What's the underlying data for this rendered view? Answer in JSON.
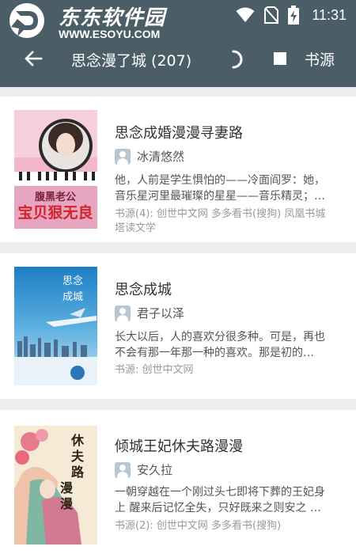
{
  "watermark": {
    "title": "东东软件园",
    "url": "WWW.ESOYU.COM"
  },
  "status_bar": {
    "time": "11:31",
    "icons": [
      "wifi-icon",
      "no-sim-icon",
      "battery-charging-icon"
    ]
  },
  "toolbar": {
    "back_icon": "arrow-left-icon",
    "title": "思念漫了城 (207)",
    "loading_icon": "spinner-icon",
    "stop_icon": "stop-icon",
    "source_label": "书源"
  },
  "colors": {
    "toolbar": "#4b5d67",
    "background": "#eeeeee",
    "card": "#ffffff"
  },
  "results": [
    {
      "title": "思念成婚漫漫寻妻路",
      "author": "冰清悠然",
      "desc_line1": "他，人前是学生惧怕的——冷面阎罗：她，",
      "desc_line2": "音乐星河里最璀璨的星星——音乐精灵；…",
      "source_line1": "书源(4): 创世中文网 多多看书(搜狗) 凤凰书城",
      "source_line2": "塔读文学",
      "cover_text": "腹黑老公 宝贝狠无良"
    },
    {
      "title": "思念成城",
      "author": "君子以泽",
      "desc_line1": "长大以后，人的喜欢分很多种。可是，再也",
      "desc_line2": "不会有那一年那一种的喜欢。那是初的…",
      "source_line1": "书源: 创世中文网",
      "source_line2": "",
      "cover_text": "思念成城"
    },
    {
      "title": "倾城王妃休夫路漫漫",
      "author": "安久拉",
      "desc_line1": "一朝穿越在一个刚过头七即将下葬的王妃身",
      "desc_line2": "上 醒来后记忆全失，只好既来之则安之 …",
      "source_line1": "书源(2): 创世中文网 多多看书(搜狗)",
      "source_line2": "",
      "cover_text": "休夫路漫漫"
    }
  ]
}
